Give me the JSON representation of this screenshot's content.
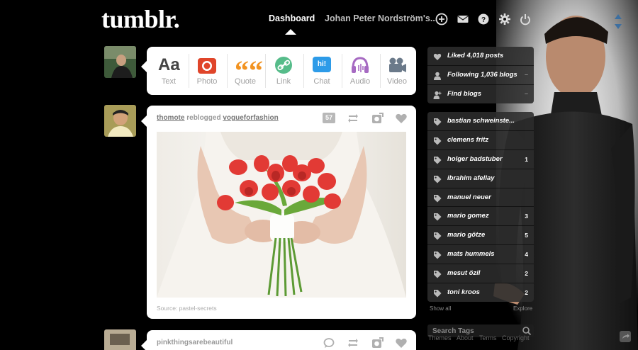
{
  "header": {
    "logo": "tumblr.",
    "nav_dashboard": "Dashboard",
    "nav_user": "Johan Peter Nordström's...",
    "icons": [
      "plus-circle-icon",
      "mail-icon",
      "help-icon",
      "gear-icon",
      "power-icon"
    ]
  },
  "post_types": [
    {
      "label": "Text",
      "glyph": "Aa",
      "color": "#444444"
    },
    {
      "label": "Photo",
      "color": "#e0452a"
    },
    {
      "label": "Quote",
      "glyph": "““",
      "color": "#f29321"
    },
    {
      "label": "Link",
      "color": "#56bc8a"
    },
    {
      "label": "Chat",
      "glyph": "hi!",
      "color": "#2d9be8"
    },
    {
      "label": "Audio",
      "color": "#a66ac2"
    },
    {
      "label": "Video",
      "color": "#6b7a8a"
    }
  ],
  "posts": [
    {
      "user": "thomote",
      "verb": "reblogged",
      "reblogged_from": "vogueforfashion",
      "notes": "57",
      "source": "Source: pastel-secrets"
    },
    {
      "user": "pinkthingsarebeautiful"
    }
  ],
  "sidebar": {
    "stats": [
      {
        "label": "Liked 4,018 posts",
        "icon": "heart-icon"
      },
      {
        "label": "Following 1,036 blogs",
        "icon": "person-icon"
      },
      {
        "label": "Find blogs",
        "icon": "add-person-icon"
      }
    ],
    "tags": [
      {
        "label": "bastian schweinste...",
        "count": ""
      },
      {
        "label": "clemens fritz",
        "count": ""
      },
      {
        "label": "holger badstuber",
        "count": "1"
      },
      {
        "label": "ibrahim afellay",
        "count": ""
      },
      {
        "label": "manuel neuer",
        "count": ""
      },
      {
        "label": "mario gomez",
        "count": "3"
      },
      {
        "label": "mario götze",
        "count": "5"
      },
      {
        "label": "mats hummels",
        "count": "4"
      },
      {
        "label": "mesut özil",
        "count": "2"
      },
      {
        "label": "toni kroos",
        "count": "2"
      }
    ],
    "show_all": "Show all",
    "explore": "Explore",
    "search_placeholder": "Search Tags"
  },
  "footer": {
    "links": [
      "Themes",
      "About",
      "Terms",
      "Copyright"
    ]
  }
}
